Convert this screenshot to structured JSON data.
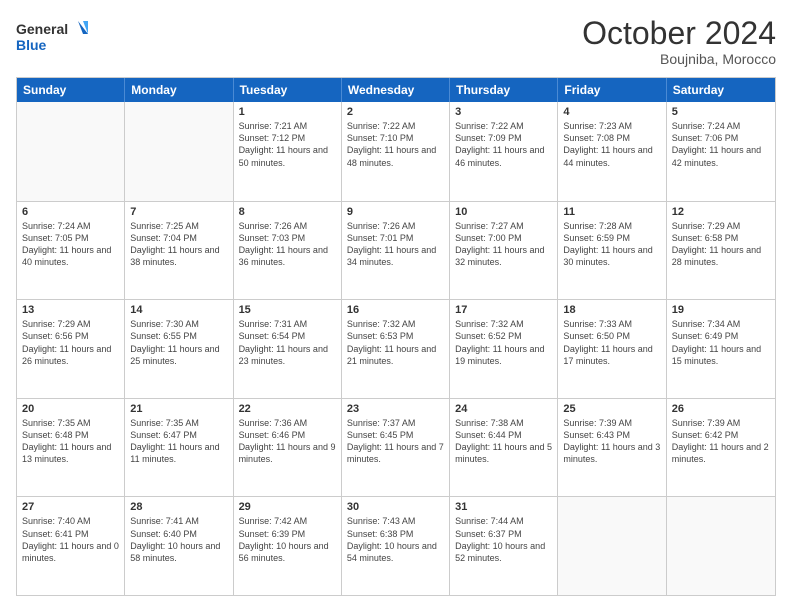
{
  "logo": {
    "text_general": "General",
    "text_blue": "Blue"
  },
  "title": "October 2024",
  "subtitle": "Boujniba, Morocco",
  "headers": [
    "Sunday",
    "Monday",
    "Tuesday",
    "Wednesday",
    "Thursday",
    "Friday",
    "Saturday"
  ],
  "weeks": [
    [
      {
        "day": "",
        "sunrise": "",
        "sunset": "",
        "daylight": "",
        "empty": true
      },
      {
        "day": "",
        "sunrise": "",
        "sunset": "",
        "daylight": "",
        "empty": true
      },
      {
        "day": "1",
        "sunrise": "Sunrise: 7:21 AM",
        "sunset": "Sunset: 7:12 PM",
        "daylight": "Daylight: 11 hours and 50 minutes.",
        "empty": false
      },
      {
        "day": "2",
        "sunrise": "Sunrise: 7:22 AM",
        "sunset": "Sunset: 7:10 PM",
        "daylight": "Daylight: 11 hours and 48 minutes.",
        "empty": false
      },
      {
        "day": "3",
        "sunrise": "Sunrise: 7:22 AM",
        "sunset": "Sunset: 7:09 PM",
        "daylight": "Daylight: 11 hours and 46 minutes.",
        "empty": false
      },
      {
        "day": "4",
        "sunrise": "Sunrise: 7:23 AM",
        "sunset": "Sunset: 7:08 PM",
        "daylight": "Daylight: 11 hours and 44 minutes.",
        "empty": false
      },
      {
        "day": "5",
        "sunrise": "Sunrise: 7:24 AM",
        "sunset": "Sunset: 7:06 PM",
        "daylight": "Daylight: 11 hours and 42 minutes.",
        "empty": false
      }
    ],
    [
      {
        "day": "6",
        "sunrise": "Sunrise: 7:24 AM",
        "sunset": "Sunset: 7:05 PM",
        "daylight": "Daylight: 11 hours and 40 minutes.",
        "empty": false
      },
      {
        "day": "7",
        "sunrise": "Sunrise: 7:25 AM",
        "sunset": "Sunset: 7:04 PM",
        "daylight": "Daylight: 11 hours and 38 minutes.",
        "empty": false
      },
      {
        "day": "8",
        "sunrise": "Sunrise: 7:26 AM",
        "sunset": "Sunset: 7:03 PM",
        "daylight": "Daylight: 11 hours and 36 minutes.",
        "empty": false
      },
      {
        "day": "9",
        "sunrise": "Sunrise: 7:26 AM",
        "sunset": "Sunset: 7:01 PM",
        "daylight": "Daylight: 11 hours and 34 minutes.",
        "empty": false
      },
      {
        "day": "10",
        "sunrise": "Sunrise: 7:27 AM",
        "sunset": "Sunset: 7:00 PM",
        "daylight": "Daylight: 11 hours and 32 minutes.",
        "empty": false
      },
      {
        "day": "11",
        "sunrise": "Sunrise: 7:28 AM",
        "sunset": "Sunset: 6:59 PM",
        "daylight": "Daylight: 11 hours and 30 minutes.",
        "empty": false
      },
      {
        "day": "12",
        "sunrise": "Sunrise: 7:29 AM",
        "sunset": "Sunset: 6:58 PM",
        "daylight": "Daylight: 11 hours and 28 minutes.",
        "empty": false
      }
    ],
    [
      {
        "day": "13",
        "sunrise": "Sunrise: 7:29 AM",
        "sunset": "Sunset: 6:56 PM",
        "daylight": "Daylight: 11 hours and 26 minutes.",
        "empty": false
      },
      {
        "day": "14",
        "sunrise": "Sunrise: 7:30 AM",
        "sunset": "Sunset: 6:55 PM",
        "daylight": "Daylight: 11 hours and 25 minutes.",
        "empty": false
      },
      {
        "day": "15",
        "sunrise": "Sunrise: 7:31 AM",
        "sunset": "Sunset: 6:54 PM",
        "daylight": "Daylight: 11 hours and 23 minutes.",
        "empty": false
      },
      {
        "day": "16",
        "sunrise": "Sunrise: 7:32 AM",
        "sunset": "Sunset: 6:53 PM",
        "daylight": "Daylight: 11 hours and 21 minutes.",
        "empty": false
      },
      {
        "day": "17",
        "sunrise": "Sunrise: 7:32 AM",
        "sunset": "Sunset: 6:52 PM",
        "daylight": "Daylight: 11 hours and 19 minutes.",
        "empty": false
      },
      {
        "day": "18",
        "sunrise": "Sunrise: 7:33 AM",
        "sunset": "Sunset: 6:50 PM",
        "daylight": "Daylight: 11 hours and 17 minutes.",
        "empty": false
      },
      {
        "day": "19",
        "sunrise": "Sunrise: 7:34 AM",
        "sunset": "Sunset: 6:49 PM",
        "daylight": "Daylight: 11 hours and 15 minutes.",
        "empty": false
      }
    ],
    [
      {
        "day": "20",
        "sunrise": "Sunrise: 7:35 AM",
        "sunset": "Sunset: 6:48 PM",
        "daylight": "Daylight: 11 hours and 13 minutes.",
        "empty": false
      },
      {
        "day": "21",
        "sunrise": "Sunrise: 7:35 AM",
        "sunset": "Sunset: 6:47 PM",
        "daylight": "Daylight: 11 hours and 11 minutes.",
        "empty": false
      },
      {
        "day": "22",
        "sunrise": "Sunrise: 7:36 AM",
        "sunset": "Sunset: 6:46 PM",
        "daylight": "Daylight: 11 hours and 9 minutes.",
        "empty": false
      },
      {
        "day": "23",
        "sunrise": "Sunrise: 7:37 AM",
        "sunset": "Sunset: 6:45 PM",
        "daylight": "Daylight: 11 hours and 7 minutes.",
        "empty": false
      },
      {
        "day": "24",
        "sunrise": "Sunrise: 7:38 AM",
        "sunset": "Sunset: 6:44 PM",
        "daylight": "Daylight: 11 hours and 5 minutes.",
        "empty": false
      },
      {
        "day": "25",
        "sunrise": "Sunrise: 7:39 AM",
        "sunset": "Sunset: 6:43 PM",
        "daylight": "Daylight: 11 hours and 3 minutes.",
        "empty": false
      },
      {
        "day": "26",
        "sunrise": "Sunrise: 7:39 AM",
        "sunset": "Sunset: 6:42 PM",
        "daylight": "Daylight: 11 hours and 2 minutes.",
        "empty": false
      }
    ],
    [
      {
        "day": "27",
        "sunrise": "Sunrise: 7:40 AM",
        "sunset": "Sunset: 6:41 PM",
        "daylight": "Daylight: 11 hours and 0 minutes.",
        "empty": false
      },
      {
        "day": "28",
        "sunrise": "Sunrise: 7:41 AM",
        "sunset": "Sunset: 6:40 PM",
        "daylight": "Daylight: 10 hours and 58 minutes.",
        "empty": false
      },
      {
        "day": "29",
        "sunrise": "Sunrise: 7:42 AM",
        "sunset": "Sunset: 6:39 PM",
        "daylight": "Daylight: 10 hours and 56 minutes.",
        "empty": false
      },
      {
        "day": "30",
        "sunrise": "Sunrise: 7:43 AM",
        "sunset": "Sunset: 6:38 PM",
        "daylight": "Daylight: 10 hours and 54 minutes.",
        "empty": false
      },
      {
        "day": "31",
        "sunrise": "Sunrise: 7:44 AM",
        "sunset": "Sunset: 6:37 PM",
        "daylight": "Daylight: 10 hours and 52 minutes.",
        "empty": false
      },
      {
        "day": "",
        "sunrise": "",
        "sunset": "",
        "daylight": "",
        "empty": true
      },
      {
        "day": "",
        "sunrise": "",
        "sunset": "",
        "daylight": "",
        "empty": true
      }
    ]
  ]
}
